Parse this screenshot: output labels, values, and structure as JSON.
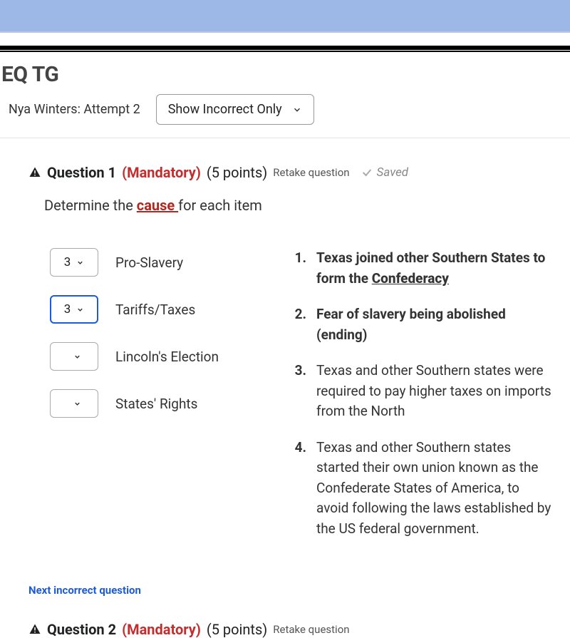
{
  "header": {
    "page_title": "EQ TG",
    "attempt_text": "Nya Winters: Attempt 2",
    "filter_label": "Show Incorrect Only"
  },
  "question1": {
    "label": "Question 1",
    "mandatory": "(Mandatory)",
    "points": "(5 points)",
    "retake": "Retake question",
    "saved": "Saved",
    "prompt_prefix": "Determine the ",
    "prompt_highlight": "cause ",
    "prompt_suffix": "for each item",
    "matches": [
      {
        "value": "3",
        "label": "Pro-Slavery",
        "focused": false
      },
      {
        "value": "3",
        "label": "Tariffs/Taxes",
        "focused": true
      },
      {
        "value": "",
        "label": "Lincoln's Election",
        "focused": false
      },
      {
        "value": "",
        "label": "States' Rights",
        "focused": false
      }
    ],
    "answers": [
      {
        "num": "1.",
        "text_pre": "Texas joined other Southern States to form the ",
        "text_bold": "Confederacy",
        "text_post": ""
      },
      {
        "num": "2.",
        "text_pre": "Fear of slavery being abolished (ending)",
        "text_bold": "",
        "text_post": ""
      },
      {
        "num": "3.",
        "text_pre": "Texas and other Southern states were required to pay higher taxes on imports from the North",
        "text_bold": "",
        "text_post": ""
      },
      {
        "num": "4.",
        "text_pre": "Texas and other Southern states started their own union known as the Confederate States of America, to avoid following the laws established by the US federal government.",
        "text_bold": "",
        "text_post": ""
      }
    ]
  },
  "next_link": "Next incorrect question",
  "question2": {
    "label": "Question 2",
    "mandatory": "(Mandatory)",
    "points": "(5 points)",
    "retake": "Retake question"
  }
}
